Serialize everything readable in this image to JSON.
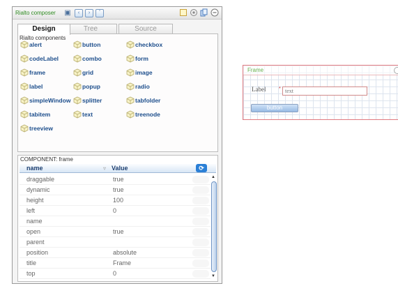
{
  "composer": {
    "title": "Rialto composer",
    "toolbar_left_icons": [
      "zoom-icon",
      "grid-left-icon",
      "grid-right-icon",
      "grid-up-icon"
    ],
    "toolbar_right_icons": [
      "new-document-icon",
      "settings-icon",
      "copy-icon",
      "minimize-icon"
    ],
    "tabs": [
      {
        "label": "Design",
        "active": true
      },
      {
        "label": "Tree",
        "active": false
      },
      {
        "label": "Source",
        "active": false
      }
    ]
  },
  "components": {
    "header": "Rialto components",
    "items": [
      {
        "label": "alert"
      },
      {
        "label": "button"
      },
      {
        "label": "checkbox"
      },
      {
        "label": "codeLabel"
      },
      {
        "label": "combo"
      },
      {
        "label": "form"
      },
      {
        "label": "frame"
      },
      {
        "label": "grid"
      },
      {
        "label": "image"
      },
      {
        "label": "label"
      },
      {
        "label": "popup"
      },
      {
        "label": "radio"
      },
      {
        "label": "simpleWindow"
      },
      {
        "label": "splitter"
      },
      {
        "label": "tabfolder"
      },
      {
        "label": "tabitem"
      },
      {
        "label": "text"
      },
      {
        "label": "treenode"
      },
      {
        "label": "treeview"
      }
    ]
  },
  "properties": {
    "header": "COMPONENT: frame",
    "col_name": "name",
    "col_value": "Value",
    "rows": [
      {
        "name": "draggable",
        "value": "true"
      },
      {
        "name": "dynamic",
        "value": "true"
      },
      {
        "name": "height",
        "value": "100"
      },
      {
        "name": "left",
        "value": "0"
      },
      {
        "name": "name",
        "value": ""
      },
      {
        "name": "open",
        "value": "true"
      },
      {
        "name": "parent",
        "value": ""
      },
      {
        "name": "position",
        "value": "absolute"
      },
      {
        "name": "title",
        "value": "Frame"
      },
      {
        "name": "top",
        "value": "0"
      }
    ]
  },
  "preview": {
    "frame_title": "Frame",
    "label_text": "Label",
    "input_value": "text",
    "button_label": "button"
  }
}
